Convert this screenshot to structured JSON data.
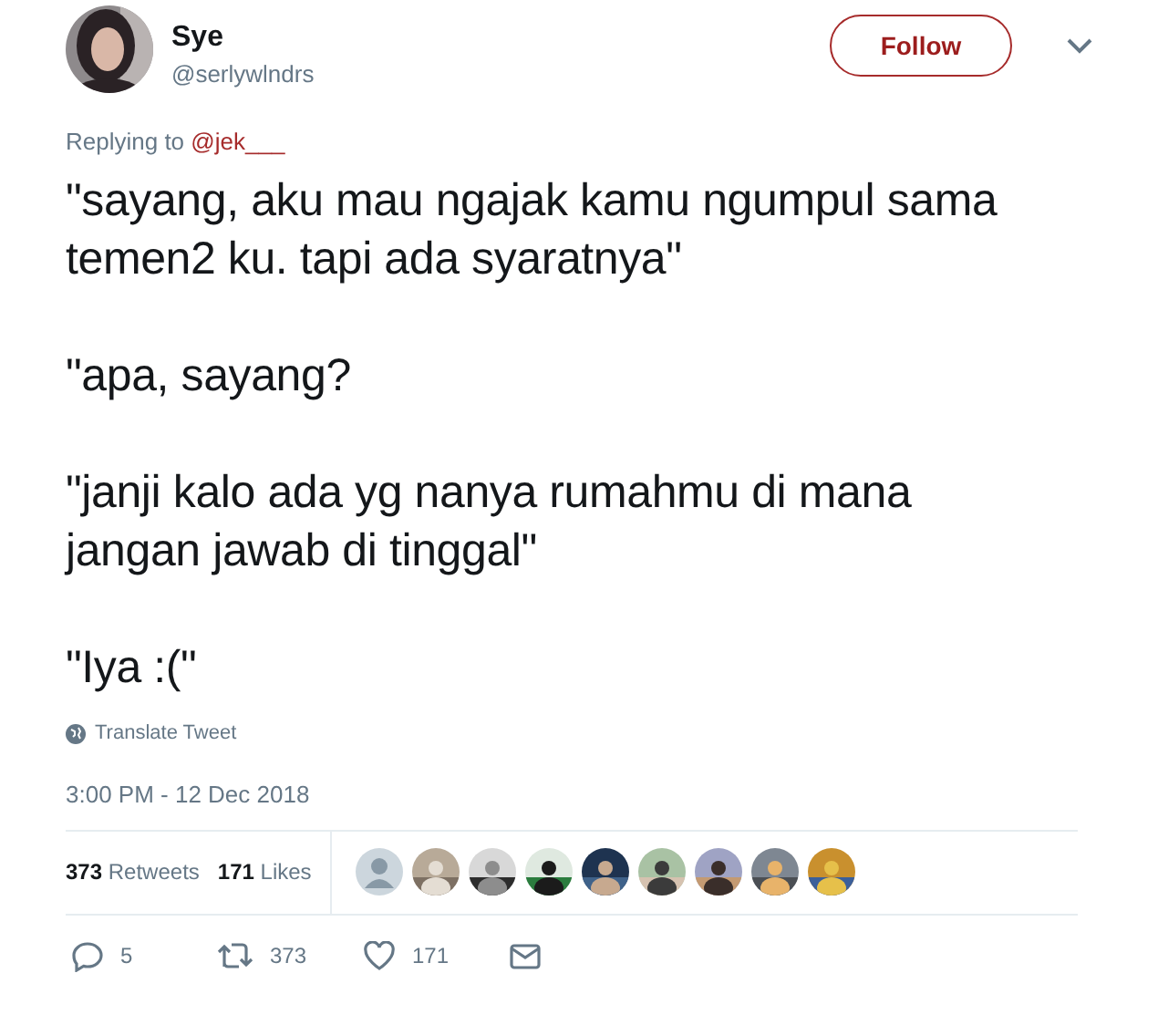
{
  "author": {
    "avatar": {
      "kind": "picture"
    },
    "name": "Sye",
    "handle": "@serlywlndrs"
  },
  "follow_button": "Follow",
  "reply_to": {
    "prefix": "Replying to",
    "handle": "@jek___"
  },
  "tweet_paragraphs": [
    "\"sayang, aku mau ngajak kamu ngumpul sama temen2 ku. tapi ada syaratnya\"",
    "\"apa, sayang?",
    "\"janji kalo ada yg nanya rumahmu di mana jangan jawab di tinggal\"",
    "\"Iya :(\""
  ],
  "translate": "Translate Tweet",
  "timestamp": "3:00 PM - 12 Dec 2018",
  "stats": [
    {
      "count": "373",
      "label": "Retweets"
    },
    {
      "count": "171",
      "label": "Likes"
    }
  ],
  "liked_by": [
    {
      "kind": "default"
    },
    {
      "kind": "picture"
    },
    {
      "kind": "picture"
    },
    {
      "kind": "picture"
    },
    {
      "kind": "picture"
    },
    {
      "kind": "picture"
    },
    {
      "kind": "picture"
    },
    {
      "kind": "picture"
    },
    {
      "kind": "picture"
    }
  ],
  "actions": [
    {
      "kind": "reply",
      "count": "5"
    },
    {
      "kind": "retweet",
      "count": "373"
    },
    {
      "kind": "like",
      "count": "171"
    },
    {
      "kind": "message"
    }
  ]
}
